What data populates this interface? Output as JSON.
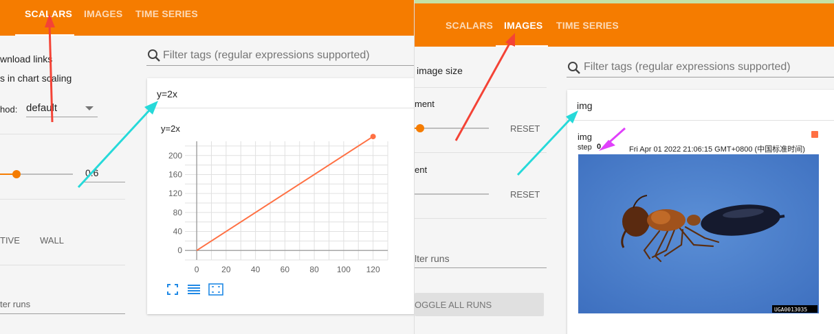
{
  "left_panel": {
    "tabs": [
      {
        "label": "SCALARS",
        "active": true
      },
      {
        "label": "IMAGES",
        "active": false
      },
      {
        "label": "TIME SERIES",
        "active": false
      }
    ],
    "sidebar": {
      "download_links_label": "wnload links",
      "chart_scaling_label": "s in chart scaling",
      "method_label": "hod:",
      "method_value": "default",
      "smoothing_value": "0.6",
      "horizontal_axis_options": [
        "TIVE",
        "WALL"
      ],
      "filter_runs_placeholder": "ter runs"
    },
    "filter_tags_placeholder": "Filter tags (regular expressions supported)",
    "card": {
      "header_title": "y=2x",
      "chart_title": "y=2x"
    }
  },
  "right_panel": {
    "tabs": [
      {
        "label": "SCALARS",
        "active": false
      },
      {
        "label": "IMAGES",
        "active": true
      },
      {
        "label": "TIME SERIES",
        "active": false
      }
    ],
    "sidebar": {
      "image_size_label": "image size",
      "brightness_label": "ment",
      "contrast_label": "ent",
      "reset_label": "RESET",
      "filter_runs_placeholder": "lter runs",
      "toggle_all_runs_label": "OGGLE ALL RUNS"
    },
    "filter_tags_placeholder": "Filter tags (regular expressions supported)",
    "card": {
      "header_title": "img",
      "image_tag": "img",
      "step_label": "step",
      "step_value": "0",
      "timestamp": "Fri Apr 01 2022 21:06:15 GMT+0800 (中国标准时间)",
      "image_watermark": "UGA0013035"
    }
  },
  "chart_data": {
    "type": "line",
    "title": "y=2x",
    "x": [
      0,
      120
    ],
    "series": [
      {
        "values": [
          0,
          240
        ],
        "color": "#ff7043"
      }
    ],
    "xlim": [
      -8,
      130
    ],
    "ylim": [
      -20,
      230
    ],
    "xticks": [
      0,
      20,
      40,
      60,
      80,
      100,
      120
    ],
    "yticks": [
      0,
      40,
      80,
      120,
      160,
      200
    ],
    "grid": true
  },
  "colors": {
    "accent": "#f57c00",
    "red_arrow": "#f44336",
    "cyan_arrow": "#26d9d9",
    "magenta_arrow": "#e040fb"
  }
}
